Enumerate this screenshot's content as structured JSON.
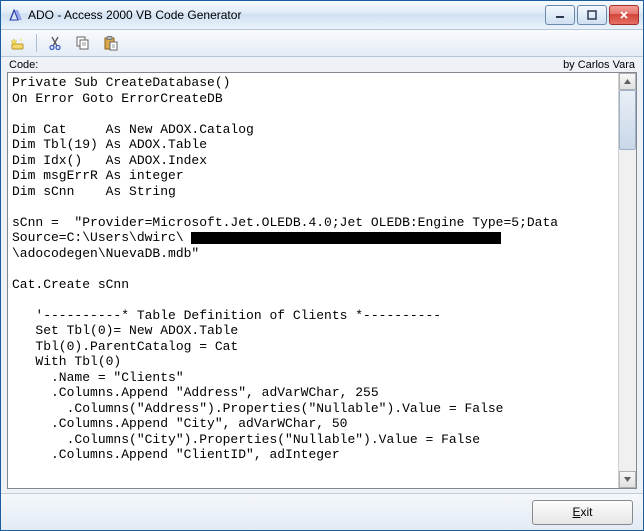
{
  "window": {
    "title": "ADO - Access 2000 VB Code Generator"
  },
  "labels": {
    "code": "Code:",
    "author": "by Carlos Vara"
  },
  "buttons": {
    "exit": "Exit"
  },
  "toolbar": {
    "items": [
      "wizard-icon",
      "cut-icon",
      "copy-icon",
      "paste-icon"
    ]
  },
  "code": {
    "lines": [
      "Private Sub CreateDatabase()",
      "On Error Goto ErrorCreateDB",
      "",
      "Dim Cat     As New ADOX.Catalog",
      "Dim Tbl(19) As ADOX.Table",
      "Dim Idx()   As ADOX.Index",
      "Dim msgErrR As integer",
      "Dim sCnn    As String",
      "",
      "sCnn =  \"Provider=Microsoft.Jet.OLEDB.4.0;Jet OLEDB:Engine Type=5;Data",
      "Source=C:\\Users\\dwirc\\",
      "\\adocodegen\\NuevaDB.mdb\"",
      "",
      "Cat.Create sCnn",
      "",
      "   '----------* Table Definition of Clients *----------",
      "   Set Tbl(0)= New ADOX.Table",
      "   Tbl(0).ParentCatalog = Cat",
      "   With Tbl(0)",
      "     .Name = \"Clients\"",
      "     .Columns.Append \"Address\", adVarWChar, 255",
      "       .Columns(\"Address\").Properties(\"Nullable\").Value = False",
      "     .Columns.Append \"City\", adVarWChar, 50",
      "       .Columns(\"City\").Properties(\"Nullable\").Value = False",
      "     .Columns.Append \"ClientID\", adInteger"
    ]
  }
}
